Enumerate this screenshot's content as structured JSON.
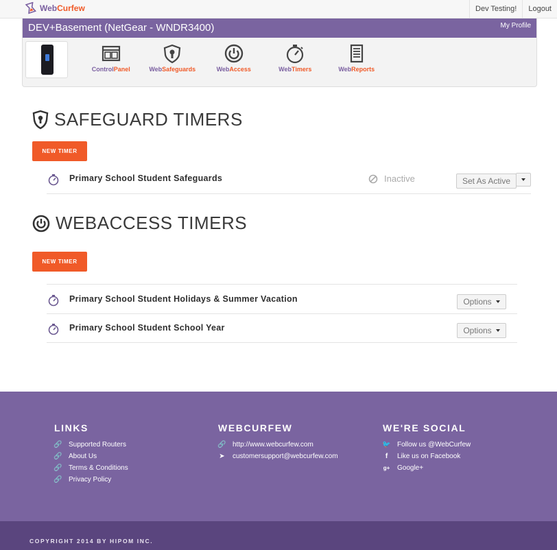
{
  "brand": {
    "part1": "Web",
    "part2": "Curfew"
  },
  "top_links": {
    "user": "Dev Testing!",
    "logout": "Logout"
  },
  "router": {
    "title": "DEV+Basement (NetGear - WNDR3400)",
    "my_profile": "My Profile"
  },
  "nav": [
    {
      "p": "Control",
      "o": "Panel",
      "icon": "control-panel-icon"
    },
    {
      "p": "Web",
      "o": "Safeguards",
      "icon": "safeguard-shield-icon"
    },
    {
      "p": "Web",
      "o": "Access",
      "icon": "power-icon"
    },
    {
      "p": "Web",
      "o": "Timers",
      "icon": "stopwatch-icon"
    },
    {
      "p": "Web",
      "o": "Reports",
      "icon": "report-document-icon"
    }
  ],
  "safeguard": {
    "title": "SAFEGUARD TIMERS",
    "new_timer": "NEW TIMER",
    "timers": [
      {
        "name": "Primary School Student Safeguards",
        "status": "Inactive",
        "action": "Set As Active"
      }
    ]
  },
  "webaccess": {
    "title": "WEBACCESS TIMERS",
    "new_timer": "NEW TIMER",
    "timers": [
      {
        "name": "Primary School Student Holidays & Summer Vacation",
        "action": "Options"
      },
      {
        "name": "Primary School Student School Year",
        "action": "Options"
      }
    ]
  },
  "footer": {
    "links": {
      "title": "LINKS",
      "items": [
        "Supported Routers",
        "About Us",
        "Terms & Conditions",
        "Privacy Policy"
      ]
    },
    "webcurfew": {
      "title": "WEBCURFEW",
      "items": [
        "http://www.webcurfew.com",
        "customersupport@webcurfew.com"
      ]
    },
    "social": {
      "title": "WE'RE SOCIAL",
      "items": [
        "Follow us @WebCurfew",
        "Like us on Facebook",
        "Google+"
      ]
    },
    "copyright": "COPYRIGHT 2014 BY HIPOM INC."
  },
  "colors": {
    "brand_purple": "#7a64a0",
    "accent_orange": "#f05a28",
    "footer_dark": "#5a457e"
  }
}
